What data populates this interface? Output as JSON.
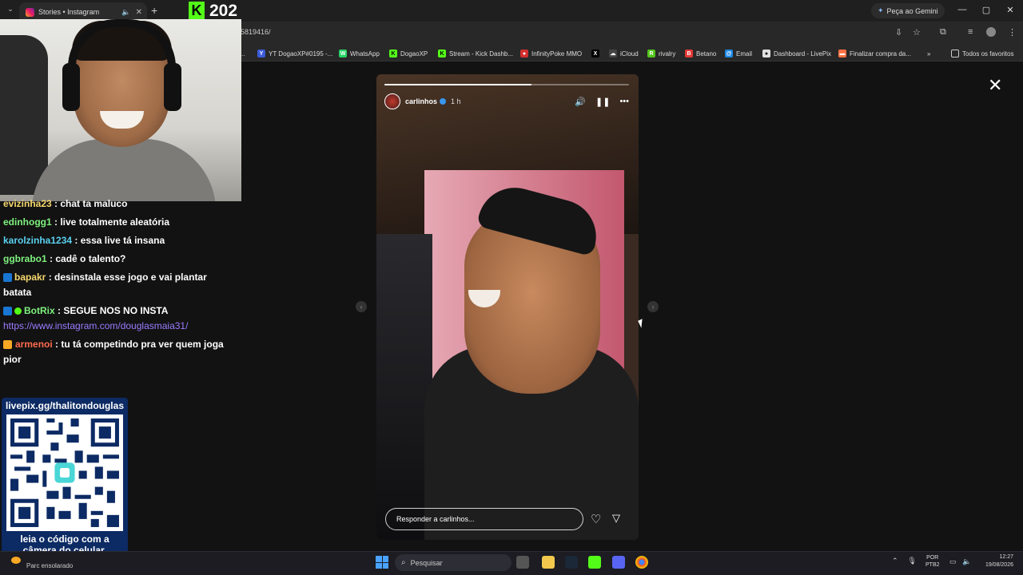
{
  "browser": {
    "tab_title": "Stories • Instagram",
    "url_fragment": "5819416/",
    "gemini_label": "Peça ao Gemini",
    "bookmarks": [
      {
        "label": "YT DogaoXP#0195 -...",
        "color": "#3a5bd9",
        "icon_text": "Y"
      },
      {
        "label": "WhatsApp",
        "color": "#25d366",
        "icon_text": "W"
      },
      {
        "label": "DogaoXP",
        "color": "#53fc18",
        "icon_text": "K"
      },
      {
        "label": "Stream - Kick Dashb...",
        "color": "#53fc18",
        "icon_text": "K"
      },
      {
        "label": "InfinityPoke MMO",
        "color": "#d32f2f",
        "icon_text": "●"
      },
      {
        "label": "",
        "color": "#000000",
        "icon_text": "X"
      },
      {
        "label": "iCloud",
        "color": "#444444",
        "icon_text": "☁"
      },
      {
        "label": "rivalry",
        "color": "#53c41a",
        "icon_text": "R"
      },
      {
        "label": "Betano",
        "color": "#e53935",
        "icon_text": "B"
      },
      {
        "label": "Email",
        "color": "#1e88e5",
        "icon_text": "@"
      },
      {
        "label": "Dashboard - LivePix",
        "color": "#e0e0e0",
        "icon_text": "●"
      },
      {
        "label": "Finalizar compra da...",
        "color": "#ff7043",
        "icon_text": "▬"
      }
    ],
    "all_favorites": "Todos os favoritos"
  },
  "kick": {
    "badge": "K",
    "viewer_count": "202"
  },
  "chat": [
    {
      "user": "evizinha23",
      "color": "#f5d76e",
      "msg": "chat ta maluco",
      "badges": []
    },
    {
      "user": "edinhogg1",
      "color": "#7ef27e",
      "msg": "live totalmente aleatória",
      "badges": []
    },
    {
      "user": "karolzinha1234",
      "color": "#5ad1f0",
      "msg": "essa live tá insana",
      "badges": []
    },
    {
      "user": "ggbrabo1",
      "color": "#7ef27e",
      "msg": "cadê o talento?",
      "badges": []
    },
    {
      "user": "bapakr",
      "color": "#f5d76e",
      "msg": "desinstala esse jogo e vai plantar batata",
      "badges": [
        "sub"
      ]
    },
    {
      "user": "BotRix",
      "color": "#7ef27e",
      "msg": "SEGUE NOS NO INSTA",
      "link": "https://www.instagram.com/douglasmaia31/",
      "badges": [
        "sub",
        "ok"
      ]
    },
    {
      "user": "armenoi",
      "color": "#ff6a4d",
      "msg": "tu tá competindo pra ver quem joga pior",
      "badges": [
        "crown"
      ]
    }
  ],
  "qr": {
    "top_text": "livepix.gg/thalitondouglas",
    "bottom_line1": "leia o código com a",
    "bottom_line2": "câmera do celular."
  },
  "story": {
    "username": "carlinhos",
    "time": "1 h",
    "reply_placeholder": "Responder a carlinhos...",
    "progress": 0.6
  },
  "taskbar": {
    "weather": "Parc ensolarado",
    "search_placeholder": "Pesquisar",
    "lang_line1": "POR",
    "lang_line2": "PTB2",
    "time": "12:27",
    "date": "19/08/2026"
  }
}
